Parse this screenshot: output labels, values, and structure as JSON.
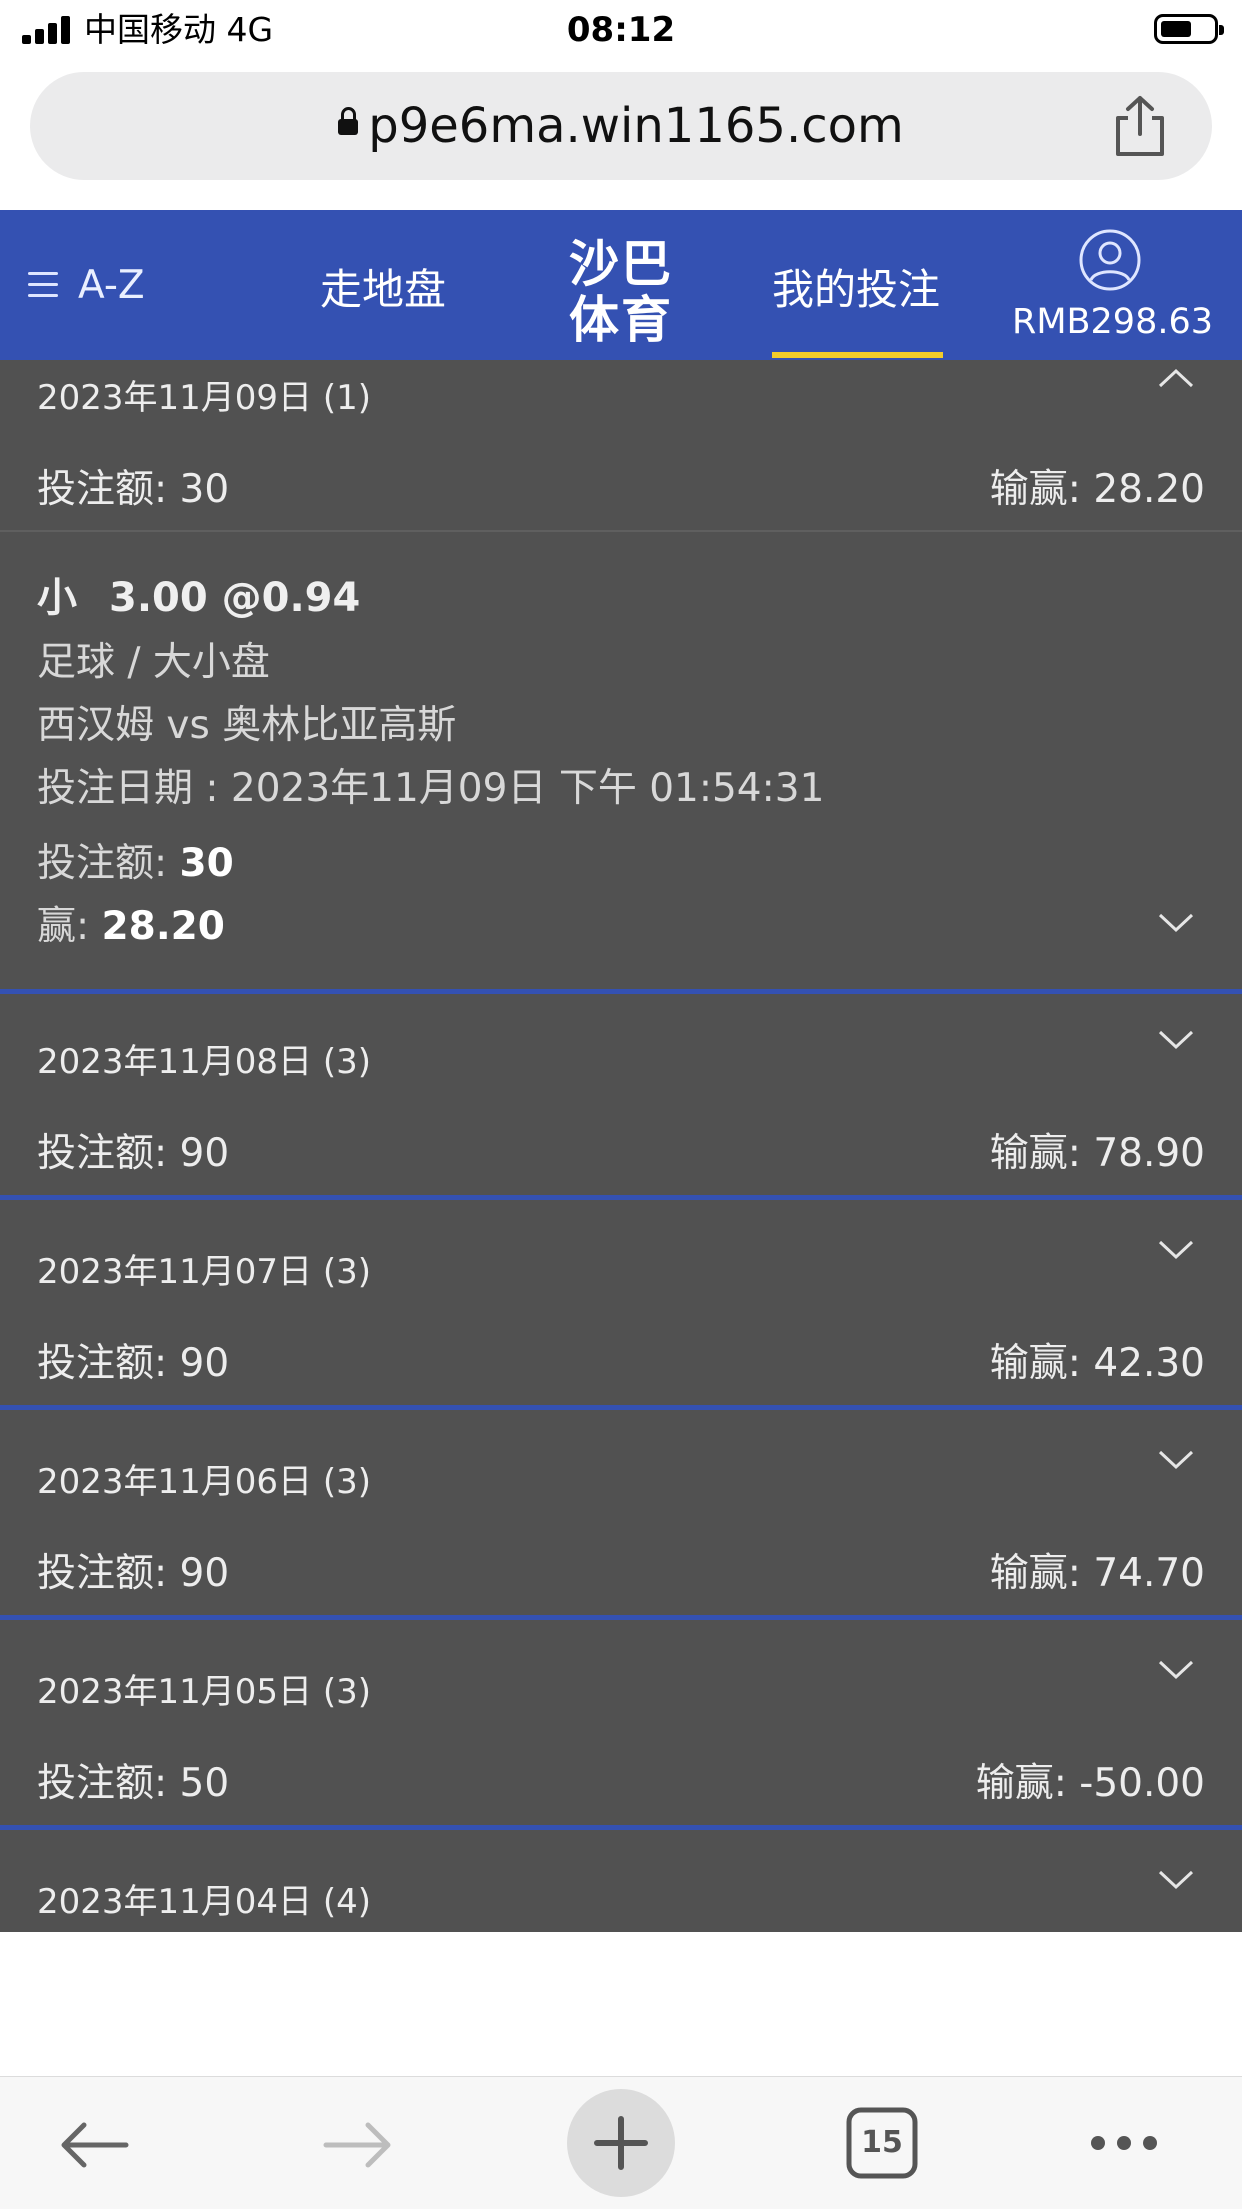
{
  "status_bar": {
    "carrier": "中国移动  4G",
    "time": "08:12"
  },
  "browser": {
    "url": "p9e6ma.win1165.com",
    "tab_count": "15"
  },
  "header": {
    "menu_label": "A-Z",
    "nav_live": "走地盘",
    "logo_line1": "沙巴",
    "logo_line2": "体育",
    "nav_mybets": "我的投注",
    "balance": "RMB298.63"
  },
  "labels": {
    "stake": "投注额:",
    "winloss": "输赢:",
    "win": "赢:"
  },
  "expanded_day": {
    "date": "2023年11月09日 (1)",
    "stake": "30",
    "winloss": "28.20",
    "bet": {
      "pick": "小",
      "line_odds": "3.00 @0.94",
      "sport_market": "足球 / 大小盘",
      "match": "西汉姆 vs 奥林比亚高斯",
      "bet_date": "投注日期 : 2023年11月09日 下午 01:54:31",
      "stake": "30",
      "win": "28.20"
    }
  },
  "days": [
    {
      "date": "2023年11月08日 (3)",
      "stake": "90",
      "winloss": "78.90"
    },
    {
      "date": "2023年11月07日 (3)",
      "stake": "90",
      "winloss": "42.30"
    },
    {
      "date": "2023年11月06日 (3)",
      "stake": "90",
      "winloss": "74.70"
    },
    {
      "date": "2023年11月05日 (3)",
      "stake": "50",
      "winloss": "-50.00"
    },
    {
      "date": "2023年11月04日 (4)"
    }
  ],
  "icons": {
    "menu": "hamburger-icon",
    "account": "user-circle-icon",
    "expand": "chevron-down-icon",
    "collapse": "chevron-up-icon",
    "share": "share-icon",
    "back": "back-arrow-icon",
    "forward": "forward-arrow-icon",
    "new_tab": "plus-icon",
    "tabs": "tabs-icon",
    "more": "more-icon"
  },
  "colors": {
    "brand_blue": "#3451b2",
    "accent_yellow": "#f2cc2a",
    "panel": "#515151"
  }
}
